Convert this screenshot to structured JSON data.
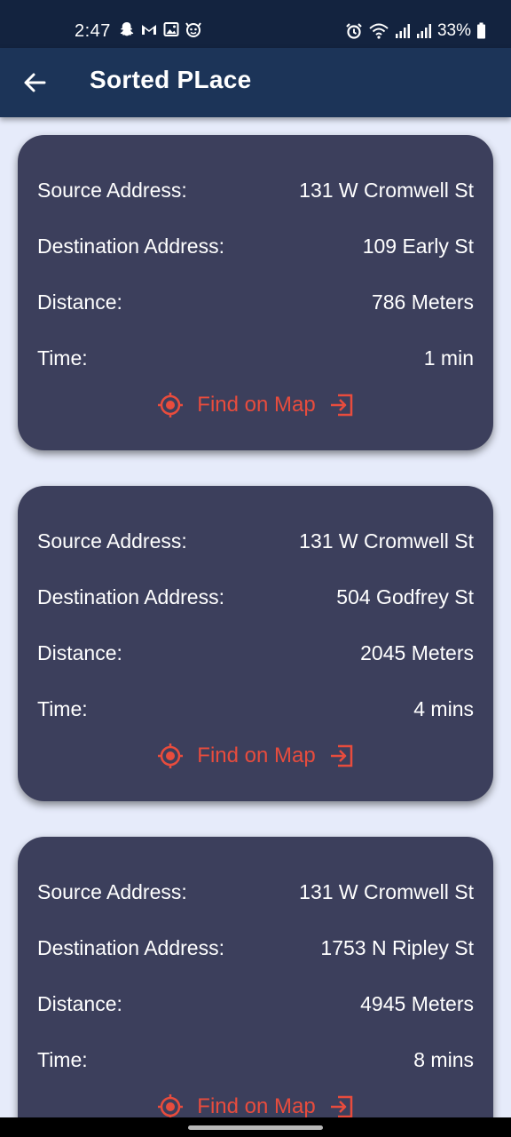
{
  "status_bar": {
    "time": "2:47",
    "battery": "33%",
    "left_icons": [
      "snapchat-icon",
      "gmail-icon",
      "gallery-icon",
      "face-icon"
    ],
    "right_icons": [
      "alarm-icon",
      "wifi-icon",
      "signal-icon",
      "signal-icon",
      "battery-icon"
    ]
  },
  "app_bar": {
    "title": "Sorted PLace",
    "back_icon": "arrow-left-icon"
  },
  "colors": {
    "status_bar": "#13233f",
    "app_bar": "#1c3458",
    "background": "#e6ebfa",
    "card": "#3c3f5c",
    "accent": "#e84c3d"
  },
  "labels": {
    "source": "Source Address:",
    "destination": "Destination Address:",
    "distance": "Distance:",
    "time": "Time:",
    "find_on_map": "Find on Map"
  },
  "places": [
    {
      "source": "131 W Cromwell St",
      "destination": "109 Early St",
      "distance": "786 Meters",
      "time": "1 min"
    },
    {
      "source": "131 W Cromwell St",
      "destination": "504 Godfrey St",
      "distance": "2045 Meters",
      "time": "4 mins"
    },
    {
      "source": "131 W Cromwell St",
      "destination": "1753 N Ripley St",
      "distance": "4945 Meters",
      "time": "8 mins"
    }
  ]
}
